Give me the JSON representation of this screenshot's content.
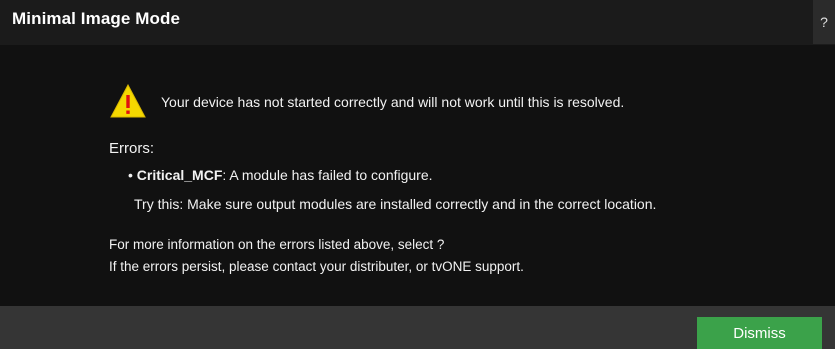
{
  "dialog": {
    "title": "Minimal Image Mode",
    "help_label": "?"
  },
  "warning": {
    "icon": "warning-icon",
    "icon_color": "#f5d800",
    "message": "Your device has not started correctly and will not work until this is resolved."
  },
  "errors": {
    "heading": "Errors:",
    "items": [
      {
        "bullet": "•",
        "name": "Critical_MCF",
        "description": ": A module has failed to configure.",
        "try_this": "Try this: Make sure output modules are installed correctly and in the correct location."
      }
    ]
  },
  "info": {
    "line1": "For more information on the errors listed above, select ?",
    "line2": "If the errors persist, please contact your distributer, or tvONE support."
  },
  "footer": {
    "dismiss_label": "Dismiss",
    "dismiss_color": "#3ba24a"
  }
}
